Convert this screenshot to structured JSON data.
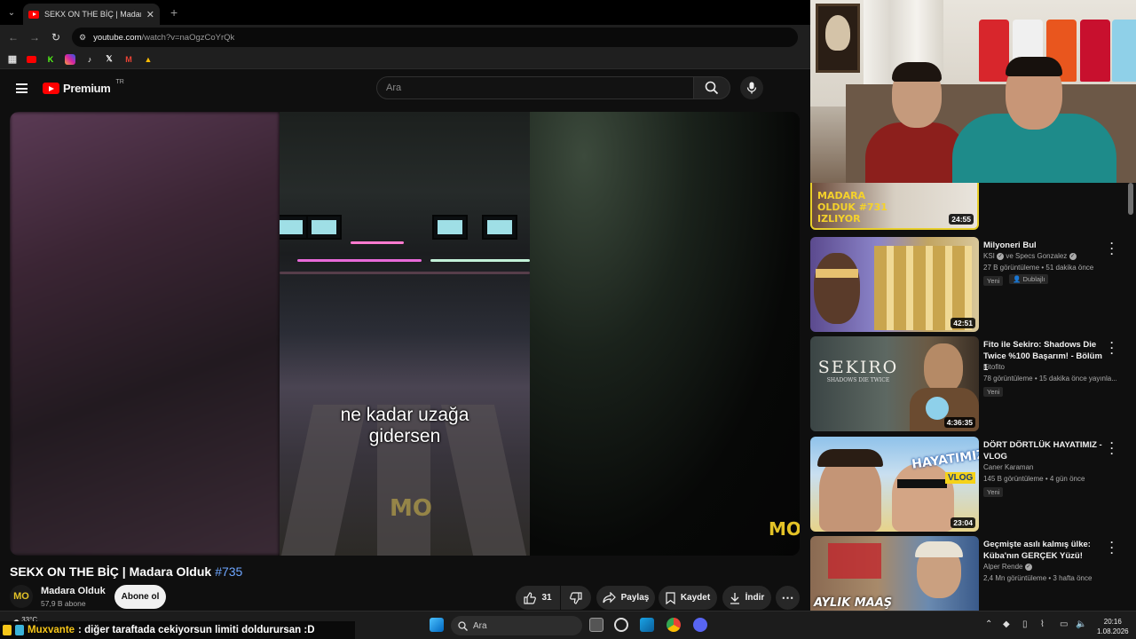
{
  "browser": {
    "tab_title": "SEKX ON THE BİÇ | Madara Olduk",
    "url_host": "youtube.com",
    "url_path": "/watch?v=naOgzCoYrQk"
  },
  "header": {
    "brand": "Premium",
    "region": "TR",
    "search_placeholder": "Ara"
  },
  "video": {
    "caption_line1": "ne kadar uzağa",
    "caption_line2": "gidersen",
    "title": "SEKX ON THE BİÇ | Madara Olduk",
    "hashtag": "#735",
    "channel": "Madara Olduk",
    "subscribers": "57,9 B abone",
    "subscribe_label": "Abone ol",
    "likes": "31",
    "share_label": "Paylaş",
    "save_label": "Kaydet",
    "download_label": "İndir"
  },
  "recommendations": [
    {
      "title": "",
      "thumb_text": "MADARA OLDUK #731 IZLIYOR",
      "duration": "24:55"
    },
    {
      "title": "Milyoneri Bul",
      "channel": "KSI",
      "channel_extra": "ve Specs Gonzalez",
      "meta": "27 B görüntüleme • 51 dakika önce",
      "badge": "Yeni",
      "badge2": "Dublajlı",
      "duration": "42:51"
    },
    {
      "title": "Fito ile Sekiro: Shadows Die Twice %100 Başarım!  - Bölüm 1",
      "channel": "Fitofito",
      "meta": "78 görüntüleme • 15 dakika önce yayınla...",
      "badge": "Yeni",
      "duration": "4:36:35",
      "thumb_text": "SEKIRO",
      "thumb_sub": "SHADOWS DIE TWICE"
    },
    {
      "title": "DÖRT DÖRTLÜK HAYATIMIZ - VLOG",
      "channel": "Caner Karaman",
      "meta": "145 B görüntüleme • 4 gün önce",
      "badge": "Yeni",
      "duration": "23:04",
      "thumb_text": "HAYATIMIZ",
      "thumb_sub": "VLOG"
    },
    {
      "title": "Geçmişte asılı kalmış ülke: Küba'nın GERÇEK Yüzü!",
      "channel": "Alper Rende",
      "meta": "2,4 Mn görüntüleme • 3 hafta önce",
      "thumb_text": "AYLIK MAAŞ"
    }
  ],
  "taskbar": {
    "temp": "33°C",
    "search": "Ara",
    "time": "20:16",
    "date": "1.08.2026"
  },
  "chat": {
    "user": "Muxvante",
    "message": ": diğer taraftada cekiyorsun limiti doldurursan :D"
  },
  "colors": {
    "youtube_red": "#ff0000",
    "accent_blue": "#6ea6ff",
    "background": "#0f0f0f"
  }
}
